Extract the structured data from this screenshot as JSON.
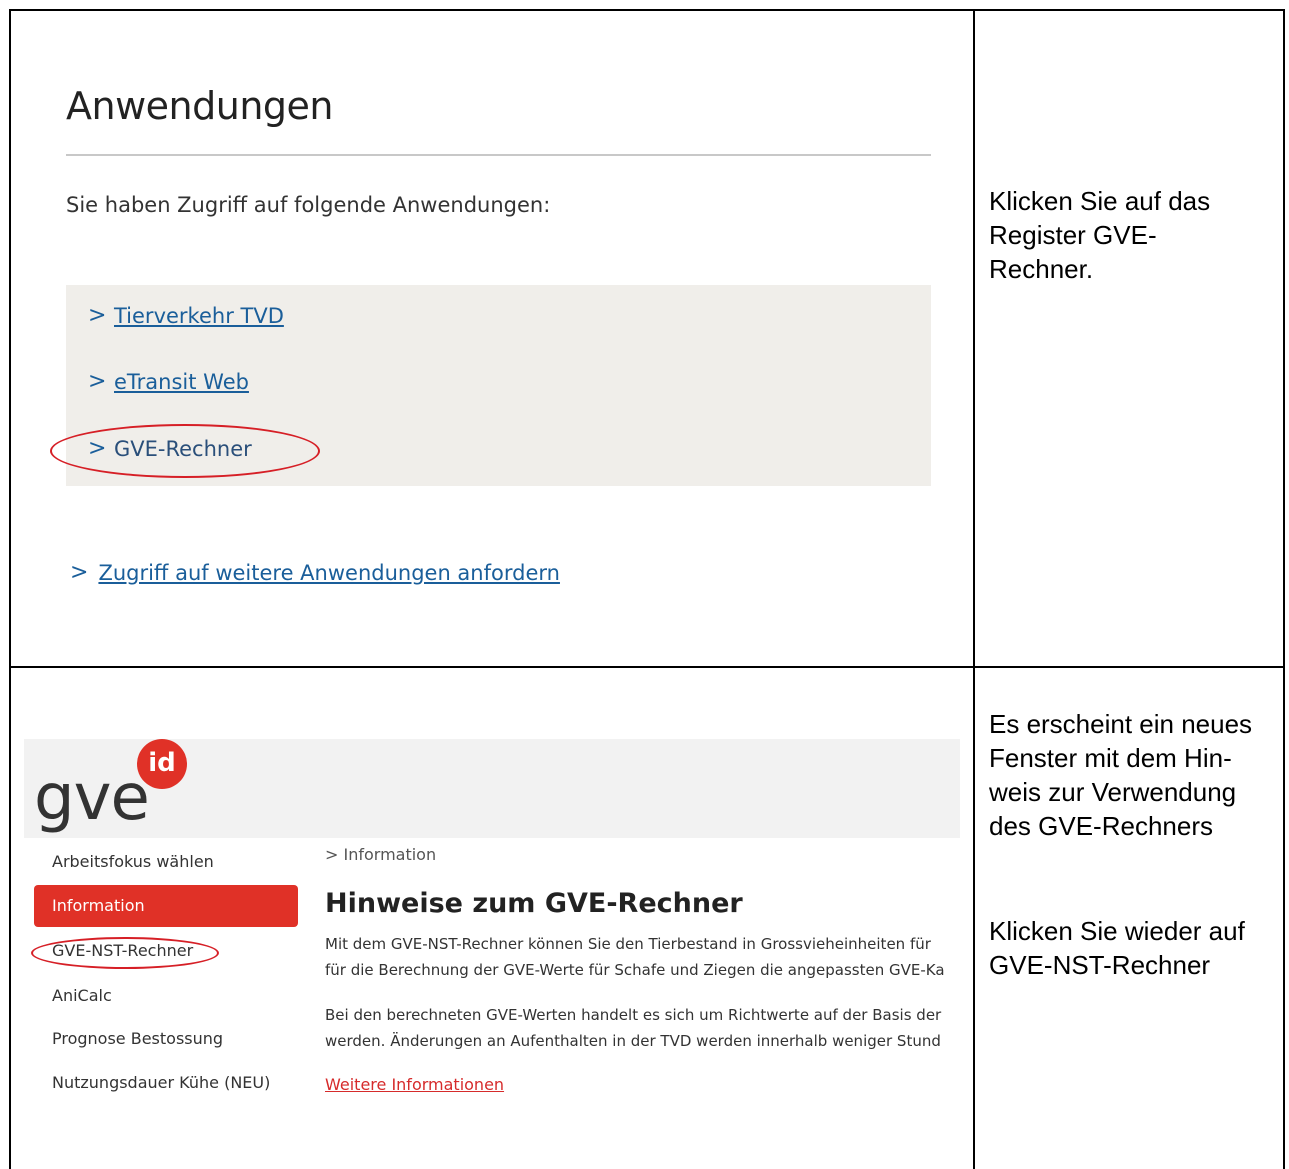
{
  "row1": {
    "screenshot": {
      "title": "Anwendungen",
      "intro": "Sie haben Zugriff auf folgende Anwendungen:",
      "apps": [
        {
          "chevron": ">",
          "label": "Tierverkehr TVD"
        },
        {
          "chevron": ">",
          "label": "eTransit Web"
        },
        {
          "chevron": ">",
          "label": "GVE-Rechner"
        }
      ],
      "more": {
        "chevron": ">",
        "label": "Zugriff auf weitere Anwendungen anfordern"
      }
    },
    "instruction": {
      "line1": "Klicken Sie auf das",
      "line2": "Register GVE-",
      "line3": "Rechner."
    }
  },
  "row2": {
    "screenshot": {
      "logo_text": "gve",
      "logo_badge": "id",
      "sidebar": [
        "Arbeitsfokus wählen",
        "Information",
        "GVE-NST-Rechner",
        "AniCalc",
        "Prognose Bestossung",
        "Nutzungsdauer Kühe (NEU)"
      ],
      "breadcrumb": "> Information",
      "heading": "Hinweise zum GVE-Rechner",
      "paragraphs": [
        "Mit dem GVE-NST-Rechner können Sie den Tierbestand in Grossvieheinheiten für",
        "für die Berechnung der GVE-Werte für Schafe und Ziegen die angepassten GVE-Ka",
        "Bei den berechneten GVE-Werten handelt es sich um Richtwerte auf der Basis der",
        "werden. Änderungen an Aufenthalten in der TVD werden innerhalb weniger Stund"
      ],
      "more_link": "Weitere Informationen"
    },
    "instruction": {
      "line1": "Es erscheint ein neues",
      "line2": "Fenster mit dem Hin-",
      "line3": "weis zur Verwendung",
      "line4": "des GVE-Rechners",
      "line5": "Klicken Sie wieder auf",
      "line6": "GVE-NST-Rechner"
    }
  },
  "colors": {
    "link": "#1a5e9a",
    "highlight": "#d61f26",
    "brand_red": "#e03127",
    "panel_bg": "#f0eeea"
  }
}
